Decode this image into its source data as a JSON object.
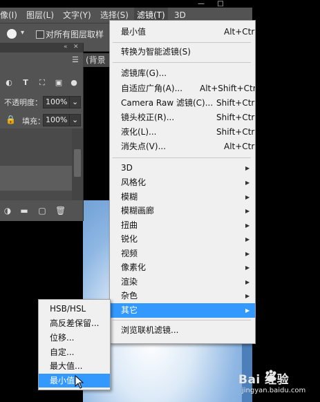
{
  "menubar": {
    "items": [
      {
        "label": "像(I)"
      },
      {
        "label": "图层(L)"
      },
      {
        "label": "文字(Y)"
      },
      {
        "label": "选择(S)"
      },
      {
        "label": "滤镜(T)"
      },
      {
        "label": "3D"
      }
    ],
    "window_controls": [
      "—",
      "□"
    ]
  },
  "options_bar": {
    "sample_all_layers_label": "对所有图层取样",
    "sample_all_layers_checked": false
  },
  "document_tab": {
    "label": "(背景"
  },
  "layers_panel": {
    "opacity_label": "不透明度：",
    "opacity_value": "100%",
    "fill_label": "填充：",
    "fill_value": "100%"
  },
  "filter_menu": {
    "last_filter": {
      "label": "最小值",
      "shortcut": "Alt+Ctrl+F"
    },
    "convert_smart": {
      "label": "转换为智能滤镜(S)"
    },
    "filter_gallery": {
      "label": "滤镜库(G)..."
    },
    "adaptive_wide": {
      "label": "自适应广角(A)...",
      "shortcut": "Alt+Shift+Ctrl+A"
    },
    "camera_raw": {
      "label": "Camera Raw 滤镜(C)...",
      "shortcut": "Shift+Ctrl+A"
    },
    "lens_correction": {
      "label": "镜头校正(R)...",
      "shortcut": "Shift+Ctrl+R"
    },
    "liquify": {
      "label": "液化(L)...",
      "shortcut": "Shift+Ctrl+X"
    },
    "vanishing_point": {
      "label": "消失点(V)...",
      "shortcut": "Alt+Ctrl+V"
    },
    "submenus": [
      {
        "label": "3D"
      },
      {
        "label": "风格化"
      },
      {
        "label": "模糊"
      },
      {
        "label": "模糊画廊"
      },
      {
        "label": "扭曲"
      },
      {
        "label": "锐化"
      },
      {
        "label": "视频"
      },
      {
        "label": "像素化"
      },
      {
        "label": "渲染"
      },
      {
        "label": "杂色"
      },
      {
        "label": "其它"
      }
    ],
    "browse_online": {
      "label": "浏览联机滤镜..."
    },
    "highlighted": "其它"
  },
  "other_submenu": {
    "items": [
      {
        "label": "HSB/HSL"
      },
      {
        "label": "高反差保留..."
      },
      {
        "label": "位移..."
      },
      {
        "label": "自定..."
      },
      {
        "label": "最大值..."
      },
      {
        "label": "最小值..."
      }
    ],
    "highlighted": "最小值..."
  },
  "watermark": {
    "text": "Bai 经验",
    "sub": "jingyan.baidu.com"
  },
  "colors": {
    "highlight": "#3399ff",
    "menu_bg": "#f0f0f0",
    "ui_dark": "#535353"
  }
}
